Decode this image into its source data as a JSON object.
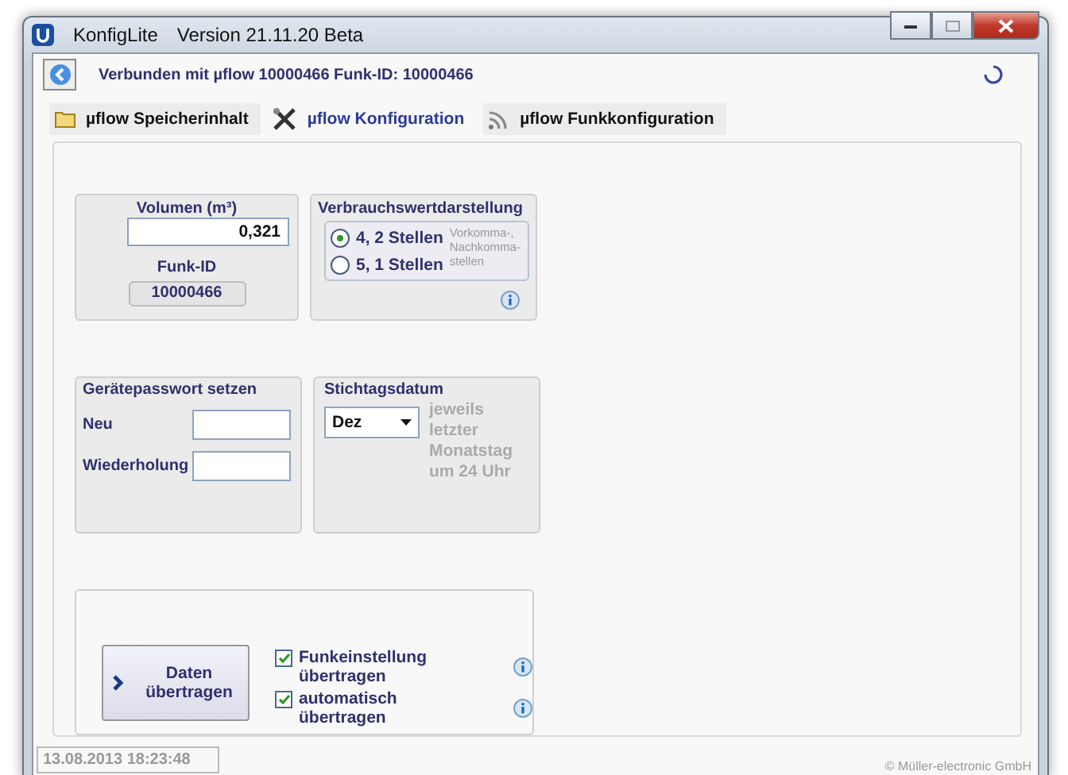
{
  "window": {
    "title": "KonfigLite",
    "version": "Version 21.11.20 Beta"
  },
  "header": {
    "status": "Verbunden mit µflow 10000466 Funk-ID: 10000466"
  },
  "tabs": [
    {
      "label": "µflow Speicherinhalt",
      "selected": false,
      "kind": "folder"
    },
    {
      "label": "µflow Konfiguration",
      "selected": true,
      "kind": "tools"
    },
    {
      "label": "µflow Funkkonfiguration",
      "selected": false,
      "kind": "wireless"
    }
  ],
  "volume": {
    "title": "Volumen (m³)",
    "value": "0,321",
    "id_label": "Funk-ID",
    "id_value": "10000466"
  },
  "display": {
    "title": "Verbrauchswertdarstellung",
    "options": [
      {
        "label": "4, 2 Stellen",
        "selected": true
      },
      {
        "label": "5, 1 Stellen",
        "selected": false
      }
    ],
    "note_lines": [
      "Vorkomma-,",
      "Nachkomma-",
      "stellen"
    ]
  },
  "password": {
    "title": "Gerätepasswort setzen",
    "fields": [
      {
        "label": "Neu"
      },
      {
        "label": "Wiederholung"
      }
    ]
  },
  "deadline": {
    "title": "Stichtagsdatum",
    "month": "Dez",
    "note": "jeweils letzter Monatstag um 24 Uhr"
  },
  "transfer": {
    "button": "Daten übertragen",
    "options": [
      {
        "label": "Funkeinstellung übertragen",
        "checked": true
      },
      {
        "label": "automatisch übertragen",
        "checked": true
      }
    ]
  },
  "status_bar": {
    "timestamp": "13.08.2013 18:23:48",
    "copyright": "© Müller-electronic GmbH"
  }
}
